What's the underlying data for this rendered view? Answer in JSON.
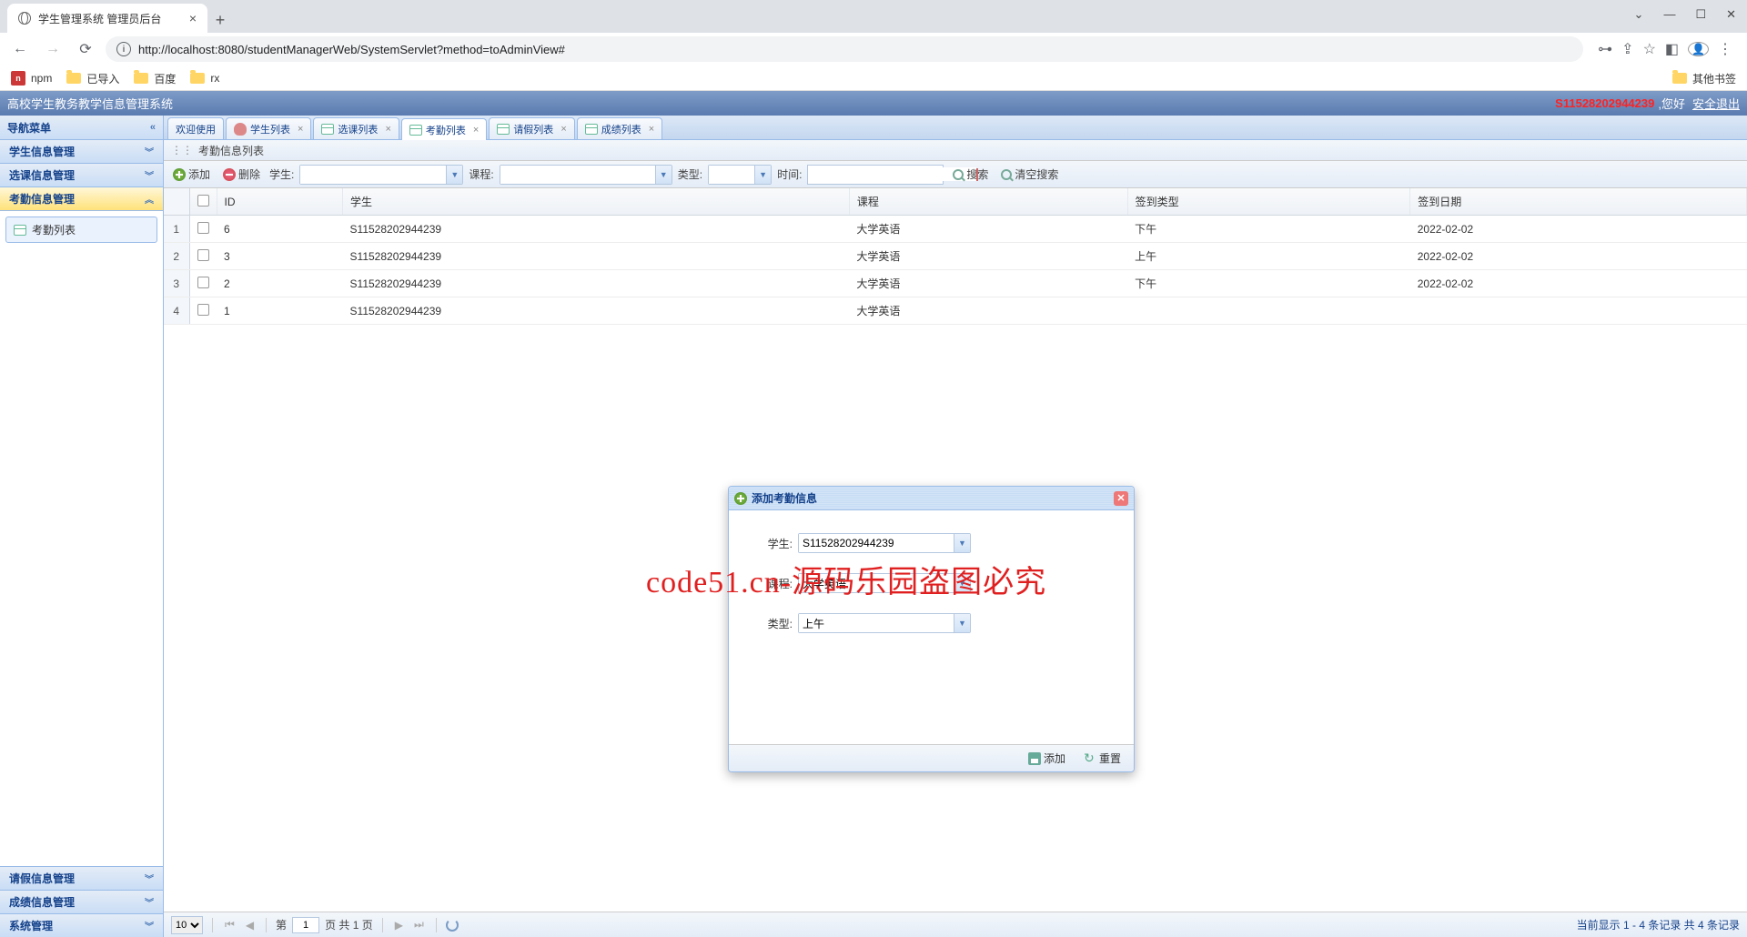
{
  "browser": {
    "tab_title": "学生管理系统 管理员后台",
    "url_full": "http://localhost:8080/studentManagerWeb/SystemServlet?method=toAdminView#",
    "bookmarks": {
      "npm": "npm",
      "imported": "已导入",
      "baidu": "百度",
      "rx": "rx",
      "other": "其他书签"
    }
  },
  "header": {
    "title": "高校学生教务教学信息管理系统",
    "user_id": "S11528202944239",
    "greeting": ",您好",
    "logout": "安全退出"
  },
  "sidebar": {
    "title": "导航菜单",
    "items": [
      "学生信息管理",
      "选课信息管理",
      "考勤信息管理",
      "请假信息管理",
      "成绩信息管理",
      "系统管理"
    ],
    "leaf": "考勤列表"
  },
  "tabs": [
    "欢迎使用",
    "学生列表",
    "选课列表",
    "考勤列表",
    "请假列表",
    "成绩列表"
  ],
  "panel_title": "考勤信息列表",
  "toolbar": {
    "add": "添加",
    "del": "删除",
    "student": "学生:",
    "course": "课程:",
    "type": "类型:",
    "time": "时间:",
    "search": "搜索",
    "clear": "清空搜索"
  },
  "table": {
    "headers": [
      "ID",
      "学生",
      "课程",
      "签到类型",
      "签到日期"
    ],
    "rows": [
      {
        "n": "1",
        "id": "6",
        "student": "S11528202944239",
        "course": "大学英语",
        "type": "下午",
        "date": "2022-02-02"
      },
      {
        "n": "2",
        "id": "3",
        "student": "S11528202944239",
        "course": "大学英语",
        "type": "上午",
        "date": "2022-02-02"
      },
      {
        "n": "3",
        "id": "2",
        "student": "S11528202944239",
        "course": "大学英语",
        "type": "下午",
        "date": "2022-02-02"
      },
      {
        "n": "4",
        "id": "1",
        "student": "S11528202944239",
        "course": "大学英语",
        "type": "",
        "date": ""
      }
    ]
  },
  "pager": {
    "page_size": "10",
    "page": "1",
    "prefix": "第",
    "mid": "页  共 1 页",
    "info": "当前显示 1 - 4 条记录  共 4 条记录"
  },
  "dialog": {
    "title": "添加考勤信息",
    "student_label": "学生:",
    "student_val": "S11528202944239",
    "course_label": "课程:",
    "course_val": "大学英语",
    "type_label": "类型:",
    "type_val": "上午",
    "add": "添加",
    "reset": "重置"
  },
  "watermark": "code51.cn-源码乐园盗图必究"
}
